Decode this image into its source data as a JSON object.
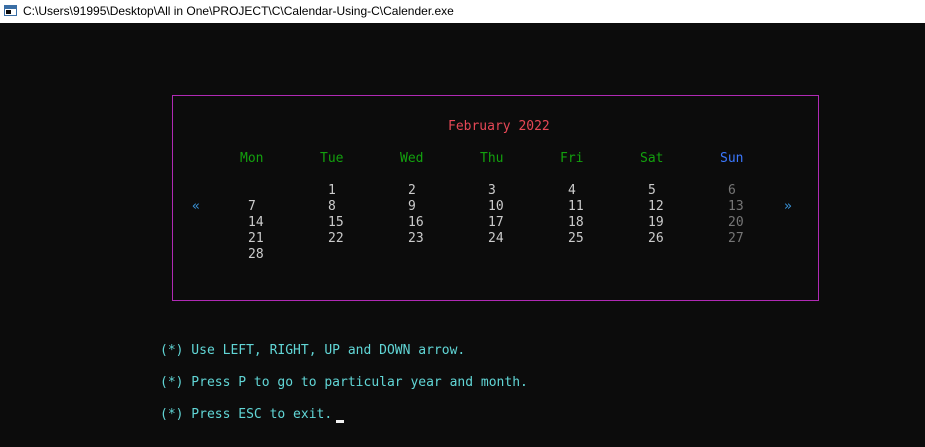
{
  "window": {
    "title": "C:\\Users\\91995\\Desktop\\All in One\\PROJECT\\C\\Calendar-Using-C\\Calender.exe"
  },
  "calendar": {
    "month_title": "February 2022",
    "weekdays": [
      "Mon",
      "Tue",
      "Wed",
      "Thu",
      "Fri",
      "Sat",
      "Sun"
    ],
    "prev_arrow": "«",
    "next_arrow": "»",
    "weeks": [
      [
        "",
        "1",
        "2",
        "3",
        "4",
        "5",
        "6"
      ],
      [
        "7",
        "8",
        "9",
        "10",
        "11",
        "12",
        "13"
      ],
      [
        "14",
        "15",
        "16",
        "17",
        "18",
        "19",
        "20"
      ],
      [
        "21",
        "22",
        "23",
        "24",
        "25",
        "26",
        "27"
      ],
      [
        "28",
        "",
        "",
        "",
        "",
        "",
        ""
      ]
    ]
  },
  "help": {
    "lines": [
      "(*) Use LEFT, RIGHT, UP and DOWN arrow.",
      "(*) Press P to go to particular year and month.",
      "(*) Press ESC to exit."
    ]
  },
  "colors": {
    "border": "#b02ab4",
    "month_title": "#e74856",
    "weekday": "#13a10e",
    "sunday_header": "#3b78ff",
    "day": "#cccccc",
    "sunday_day": "#767676",
    "nav_arrow": "#3a96dd",
    "help_text": "#61d6d6"
  }
}
